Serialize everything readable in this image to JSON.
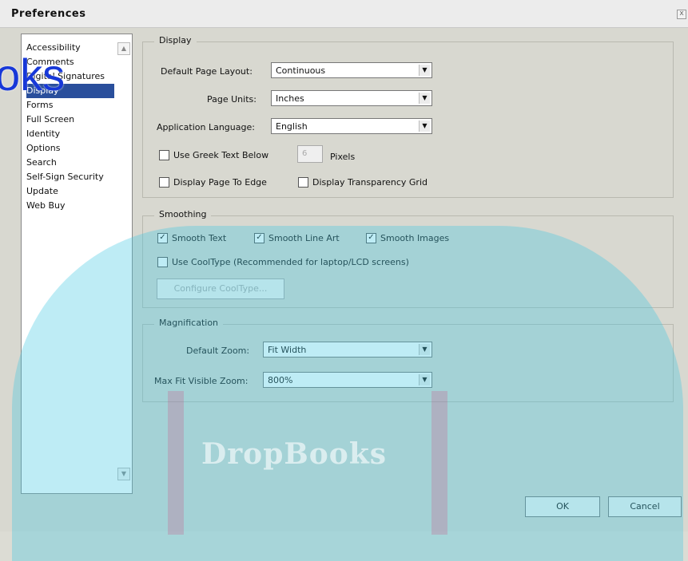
{
  "window": {
    "title": "Preferences",
    "close_glyph": "x"
  },
  "categories": {
    "items": [
      "Accessibility",
      "Comments",
      "Digital Signatures",
      "Display",
      "Forms",
      "Full Screen",
      "Identity",
      "Options",
      "Search",
      "Self-Sign Security",
      "Update",
      "Web Buy"
    ],
    "selected": "Display"
  },
  "display": {
    "title": "Display",
    "page_layout_label": "Default Page Layout:",
    "page_layout_value": "Continuous",
    "page_units_label": "Page Units:",
    "page_units_value": "Inches",
    "app_language_label": "Application Language:",
    "app_language_value": "English",
    "greek_text_label": "Use Greek Text Below",
    "greek_text_value": "6",
    "pixels_label": "Pixels",
    "page_to_edge_label": "Display Page To Edge",
    "transparency_grid_label": "Display Transparency Grid"
  },
  "smoothing": {
    "title": "Smoothing",
    "smooth_text_label": "Smooth Text",
    "smooth_line_art_label": "Smooth Line Art",
    "smooth_images_label": "Smooth Images",
    "cooltype_label": "Use CoolType (Recommended for laptop/LCD screens)",
    "configure_cooltype_label": "Configure CoolType..."
  },
  "magnification": {
    "title": "Magnification",
    "default_zoom_label": "Default Zoom:",
    "default_zoom_value": "Fit Width",
    "max_fit_zoom_label": "Max Fit Visible Zoom:",
    "max_fit_zoom_value": "800%"
  },
  "buttons": {
    "ok": "OK",
    "cancel": "Cancel"
  },
  "watermark": {
    "fragment": "oks",
    "brand": "DropBooks"
  },
  "checkboxes": {
    "greek_text": false,
    "page_to_edge": false,
    "transparency_grid": false,
    "smooth_text": true,
    "smooth_line_art": true,
    "smooth_images": true,
    "cooltype": false
  },
  "colors": {
    "selection": "#2a4f9c",
    "overlay": "#46c8e1",
    "watermark_blue": "#1738d8"
  }
}
